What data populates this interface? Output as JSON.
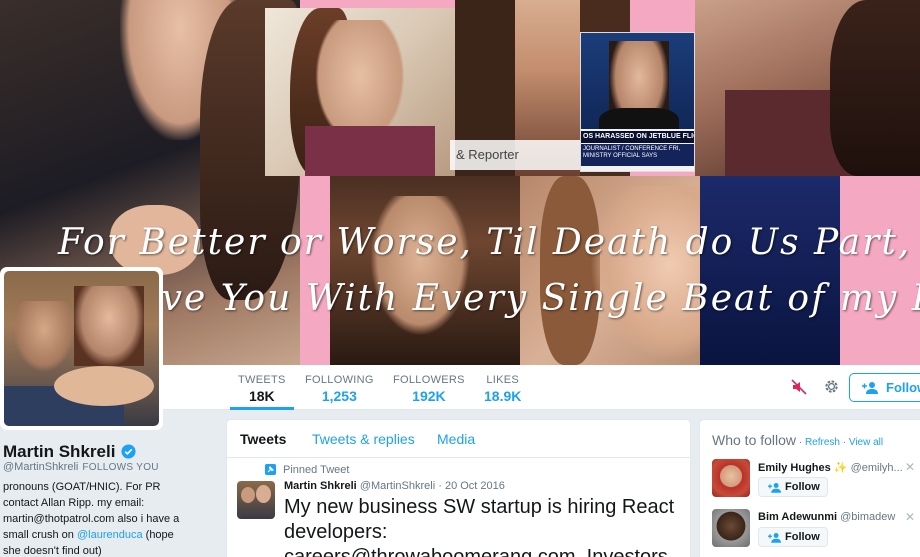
{
  "header": {
    "overlay_line1": "For Better or Worse, Til Death do Us Part,",
    "overlay_line2": "ove You With Every Single Beat of my Heart",
    "reporter_caption": "& Reporter",
    "news_chyron": "OS HARASSED ON JETBLUE FLIGHT",
    "news_sub": "JOURNALIST / CONFERENCE FRI, MINISTRY OFFICIAL SAYS"
  },
  "nav": {
    "stats": [
      {
        "label": "TWEETS",
        "value": "18K"
      },
      {
        "label": "FOLLOWING",
        "value": "1,253"
      },
      {
        "label": "FOLLOWERS",
        "value": "192K"
      },
      {
        "label": "LIKES",
        "value": "18.9K"
      }
    ],
    "follow_label": "Follow"
  },
  "profile": {
    "name": "Martin Shkreli",
    "handle": "@MartinShkreli",
    "follows_you": "FOLLOWS YOU",
    "bio_part1": "pronouns (GOAT/HNIC). For PR contact Allan Ripp. my email: martin@thotpatrol.com also i have a small crush on ",
    "bio_mention": "@laurenduca",
    "bio_part2": " (hope she doesn't find out)"
  },
  "timeline": {
    "tabs": [
      "Tweets",
      "Tweets & replies",
      "Media"
    ],
    "pinned_label": "Pinned Tweet",
    "tweet": {
      "name": "Martin Shkreli",
      "handle": "@MartinShkreli",
      "date": "· 20 Oct 2016",
      "text": "My new business SW startup is hiring React developers: careers@throwaboomerang.com. Investors"
    }
  },
  "who_to_follow": {
    "title": "Who to follow",
    "refresh": "Refresh",
    "view_all": "View all",
    "sep": " · ",
    "follow_label": "Follow",
    "suggestions": [
      {
        "name": "Emily Hughes",
        "badge": "✨",
        "handle": "@emilyh..."
      },
      {
        "name": "Bim Adewunmi",
        "badge": "",
        "handle": "@bimadew"
      }
    ]
  },
  "colors": {
    "accent": "#1da1f2",
    "header_pink": "#f4a8c2",
    "muted": "#657786"
  }
}
